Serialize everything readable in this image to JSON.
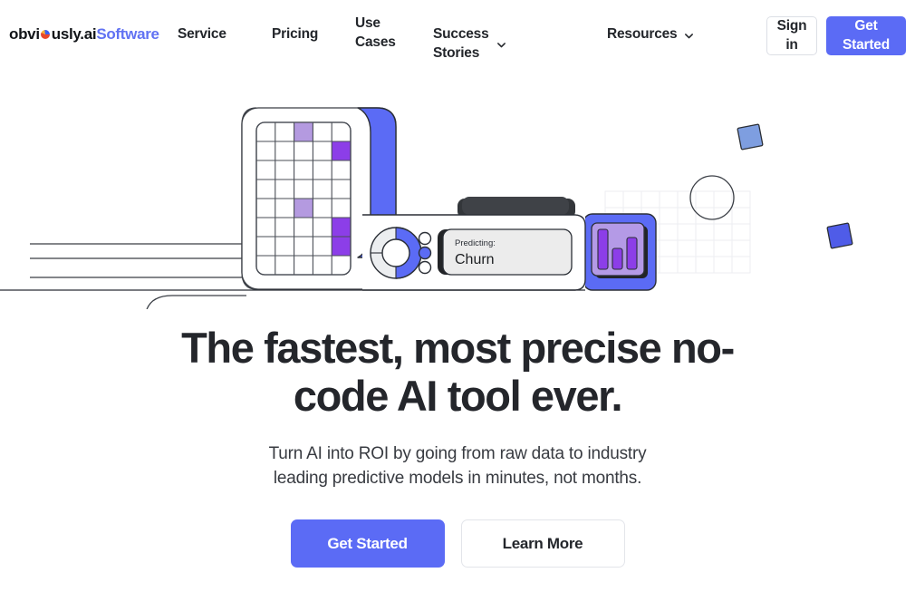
{
  "nav": {
    "brand": {
      "part_a": "obvi",
      "logo_icon": "obviously-pie-logo-icon",
      "part_a2": "usly.ai",
      "part_b": "Software"
    },
    "links": [
      {
        "label": "Service",
        "has_caret": false
      },
      {
        "label": "Pricing",
        "has_caret": false
      },
      {
        "label": "Use Cases",
        "has_caret": false
      },
      {
        "label": "Success Stories",
        "has_caret": true
      },
      {
        "label": "Resources",
        "has_caret": true
      }
    ],
    "sign_in_label": "Sign in",
    "get_started_label": "Get Started"
  },
  "hero": {
    "headline": "The fastest, most precise no-code AI tool ever.",
    "headline_line1": "The fastest, most precise no-",
    "headline_line2": "code AI tool ever.",
    "subhead_line1": "Turn AI into ROI by going from raw data to industry",
    "subhead_line2": "leading predictive models in minutes, not months.",
    "cta_primary": "Get Started",
    "cta_secondary": "Learn More"
  },
  "illustration": {
    "predicting_label": "Predicting:",
    "predicting_value": "Churn",
    "grid_columns": 5,
    "grid_rows": 8,
    "highlighted_cells": [
      {
        "row": 1,
        "col": 3,
        "shade": "light"
      },
      {
        "row": 2,
        "col": 5,
        "shade": "dark"
      },
      {
        "row": 5,
        "col": 3,
        "shade": "light"
      },
      {
        "row": 6,
        "col": 5,
        "shade": "dark"
      },
      {
        "row": 7,
        "col": 5,
        "shade": "dark"
      }
    ],
    "bar_chart_bars": [
      3,
      1,
      2
    ],
    "dial_indicator_dots": 3,
    "dial_active_dot": 2
  },
  "colors": {
    "brand_blue": "#5b6bf5",
    "brand_blue_light": "#8fb0ea",
    "purple_dark": "#8c3ee8",
    "purple_light": "#b49ae0",
    "purple_panel": "#b49ae6",
    "ink": "#24262b",
    "stroke": "#2b2f36",
    "border_light": "#e3e5ea",
    "grid_faint": "#eceef2"
  }
}
